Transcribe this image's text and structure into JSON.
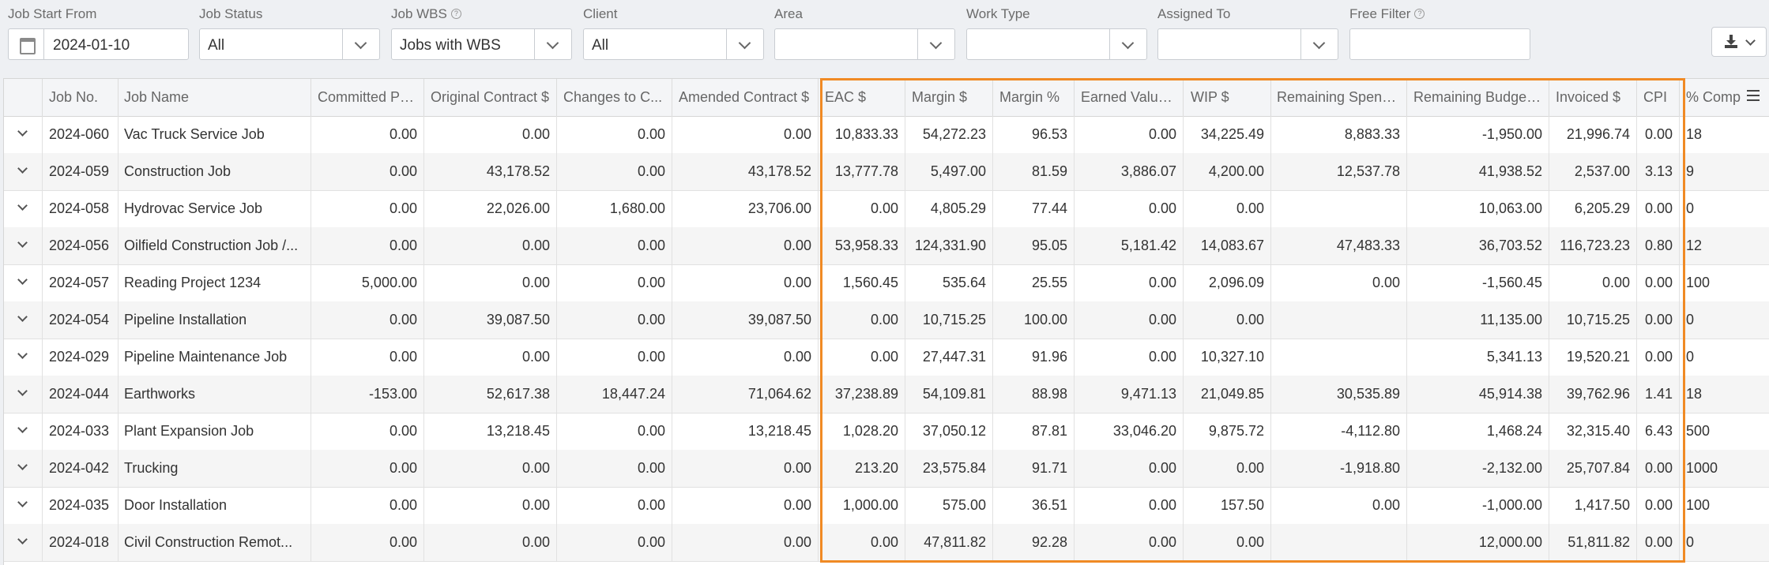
{
  "filters": {
    "job_start_from": {
      "label": "Job Start From",
      "value": "2024-01-10"
    },
    "job_status": {
      "label": "Job Status",
      "value": "All"
    },
    "job_wbs": {
      "label": "Job WBS",
      "value": "Jobs with WBS"
    },
    "client": {
      "label": "Client",
      "value": "All"
    },
    "area": {
      "label": "Area",
      "value": ""
    },
    "work_type": {
      "label": "Work Type",
      "value": ""
    },
    "assigned_to": {
      "label": "Assigned To",
      "value": ""
    },
    "free_filter": {
      "label": "Free Filter",
      "value": ""
    }
  },
  "icons": {
    "calendar": "calendar-icon",
    "help": "help-circle-icon",
    "export": "download-icon",
    "column_menu": "hamburger-menu-icon",
    "row_expand": "chevron-down-icon"
  },
  "colors": {
    "highlight": "#f08a24"
  },
  "table": {
    "columns": [
      "Job No.",
      "Job Name",
      "Committed PO$",
      "Original Contract $",
      "Changes to C...",
      "Amended Contract $",
      "EAC $",
      "Margin $",
      "Margin %",
      "Earned Value $",
      "WIP $",
      "Remaining Spend $",
      "Remaining Budget $",
      "Invoiced $",
      "CPI",
      "% Comp"
    ],
    "rows": [
      [
        "2024-060",
        "Vac Truck Service Job",
        "0.00",
        "0.00",
        "0.00",
        "0.00",
        "10,833.33",
        "54,272.23",
        "96.53",
        "0.00",
        "34,225.49",
        "8,883.33",
        "-1,950.00",
        "21,996.74",
        "0.00",
        "18"
      ],
      [
        "2024-059",
        "Construction Job",
        "0.00",
        "43,178.52",
        "0.00",
        "43,178.52",
        "13,777.78",
        "5,497.00",
        "81.59",
        "3,886.07",
        "4,200.00",
        "12,537.78",
        "41,938.52",
        "2,537.00",
        "3.13",
        "9"
      ],
      [
        "2024-058",
        "Hydrovac Service Job",
        "0.00",
        "22,026.00",
        "1,680.00",
        "23,706.00",
        "0.00",
        "4,805.29",
        "77.44",
        "0.00",
        "0.00",
        "",
        "10,063.00",
        "6,205.29",
        "0.00",
        "0"
      ],
      [
        "2024-056",
        "Oilfield Construction Job /...",
        "0.00",
        "0.00",
        "0.00",
        "0.00",
        "53,958.33",
        "124,331.90",
        "95.05",
        "5,181.42",
        "14,083.67",
        "47,483.33",
        "36,703.52",
        "116,723.23",
        "0.80",
        "12"
      ],
      [
        "2024-057",
        "Reading Project 1234",
        "5,000.00",
        "0.00",
        "0.00",
        "0.00",
        "1,560.45",
        "535.64",
        "25.55",
        "0.00",
        "2,096.09",
        "0.00",
        "-1,560.45",
        "0.00",
        "0.00",
        "100"
      ],
      [
        "2024-054",
        "Pipeline Installation",
        "0.00",
        "39,087.50",
        "0.00",
        "39,087.50",
        "0.00",
        "10,715.25",
        "100.00",
        "0.00",
        "0.00",
        "",
        "11,135.00",
        "10,715.25",
        "0.00",
        "0"
      ],
      [
        "2024-029",
        "Pipeline Maintenance Job",
        "0.00",
        "0.00",
        "0.00",
        "0.00",
        "0.00",
        "27,447.31",
        "91.96",
        "0.00",
        "10,327.10",
        "",
        "5,341.13",
        "19,520.21",
        "0.00",
        "0"
      ],
      [
        "2024-044",
        "Earthworks",
        "-153.00",
        "52,617.38",
        "18,447.24",
        "71,064.62",
        "37,238.89",
        "54,109.81",
        "88.98",
        "9,471.13",
        "21,049.85",
        "30,535.89",
        "45,914.38",
        "39,762.96",
        "1.41",
        "18"
      ],
      [
        "2024-033",
        "Plant Expansion Job",
        "0.00",
        "13,218.45",
        "0.00",
        "13,218.45",
        "1,028.20",
        "37,050.12",
        "87.81",
        "33,046.20",
        "9,875.72",
        "-4,112.80",
        "1,468.24",
        "32,315.40",
        "6.43",
        "500"
      ],
      [
        "2024-042",
        "Trucking",
        "0.00",
        "0.00",
        "0.00",
        "0.00",
        "213.20",
        "23,575.84",
        "91.71",
        "0.00",
        "0.00",
        "-1,918.80",
        "-2,132.00",
        "25,707.84",
        "0.00",
        "1000"
      ],
      [
        "2024-035",
        "Door Installation",
        "0.00",
        "0.00",
        "0.00",
        "0.00",
        "1,000.00",
        "575.00",
        "36.51",
        "0.00",
        "157.50",
        "0.00",
        "-1,000.00",
        "1,417.50",
        "0.00",
        "100"
      ],
      [
        "2024-018",
        "Civil Construction Remot...",
        "0.00",
        "0.00",
        "0.00",
        "0.00",
        "0.00",
        "47,811.82",
        "92.28",
        "0.00",
        "0.00",
        "",
        "12,000.00",
        "51,811.82",
        "0.00",
        "0"
      ]
    ]
  }
}
